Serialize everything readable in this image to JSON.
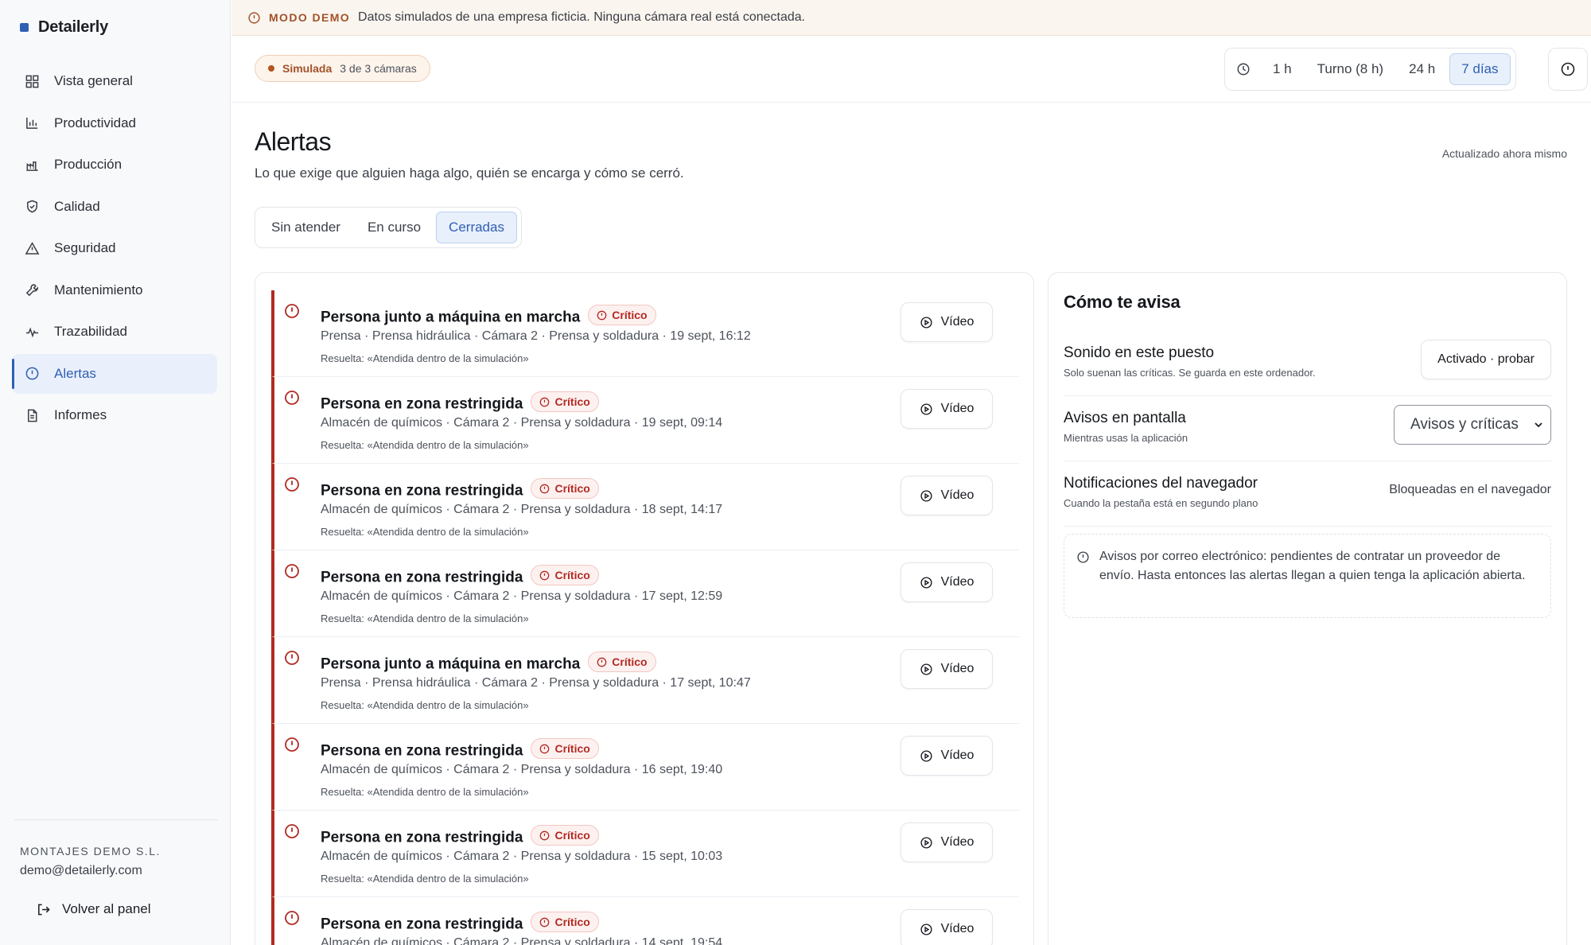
{
  "brand": {
    "name": "Detailerly",
    "color": "#2f5fb3"
  },
  "sidebar": {
    "items": [
      {
        "label": "Vista general",
        "icon": "dashboard-icon"
      },
      {
        "label": "Productividad",
        "icon": "bar-chart-icon"
      },
      {
        "label": "Producción",
        "icon": "factory-icon"
      },
      {
        "label": "Calidad",
        "icon": "shield-check-icon"
      },
      {
        "label": "Seguridad",
        "icon": "warning-triangle-icon"
      },
      {
        "label": "Mantenimiento",
        "icon": "wrench-icon"
      },
      {
        "label": "Trazabilidad",
        "icon": "pulse-icon"
      },
      {
        "label": "Alertas",
        "icon": "alert-circle-icon",
        "active": true
      },
      {
        "label": "Informes",
        "icon": "document-icon"
      }
    ],
    "company": "MONTAJES DEMO S.L.",
    "email": "demo@detailerly.com",
    "back_label": "Volver al panel"
  },
  "banner": {
    "tag": "MODO DEMO",
    "text": "Datos simulados de una empresa ficticia. Ninguna cámara real está conectada.",
    "color": "#a1522a"
  },
  "topbar": {
    "sim_label": "Simulada",
    "sim_count": "3 de 3 cámaras",
    "ranges": [
      "1 h",
      "Turno (8 h)",
      "24 h",
      "7 días"
    ],
    "active_range": "7 días"
  },
  "page": {
    "title": "Alertas",
    "subtitle": "Lo que exige que alguien haga algo, quién se encarga y cómo se cerró.",
    "updated": "Actualizado ahora mismo"
  },
  "tabs": [
    "Sin atender",
    "En curso",
    "Cerradas"
  ],
  "active_tab": "Cerradas",
  "alerts": [
    {
      "title": "Persona junto a máquina en marcha",
      "badge": "Crítico",
      "meta": "Prensa · Prensa hidráulica · Cámara 2 · Prensa y soldadura · 19 sept, 16:12",
      "resolution": "Resuelta: «Atendida dentro de la simulación»",
      "video_label": "Vídeo"
    },
    {
      "title": "Persona en zona restringida",
      "badge": "Crítico",
      "meta": "Almacén de químicos · Cámara 2 · Prensa y soldadura · 19 sept, 09:14",
      "resolution": "Resuelta: «Atendida dentro de la simulación»",
      "video_label": "Vídeo"
    },
    {
      "title": "Persona en zona restringida",
      "badge": "Crítico",
      "meta": "Almacén de químicos · Cámara 2 · Prensa y soldadura · 18 sept, 14:17",
      "resolution": "Resuelta: «Atendida dentro de la simulación»",
      "video_label": "Vídeo"
    },
    {
      "title": "Persona en zona restringida",
      "badge": "Crítico",
      "meta": "Almacén de químicos · Cámara 2 · Prensa y soldadura · 17 sept, 12:59",
      "resolution": "Resuelta: «Atendida dentro de la simulación»",
      "video_label": "Vídeo"
    },
    {
      "title": "Persona junto a máquina en marcha",
      "badge": "Crítico",
      "meta": "Prensa · Prensa hidráulica · Cámara 2 · Prensa y soldadura · 17 sept, 10:47",
      "resolution": "Resuelta: «Atendida dentro de la simulación»",
      "video_label": "Vídeo"
    },
    {
      "title": "Persona en zona restringida",
      "badge": "Crítico",
      "meta": "Almacén de químicos · Cámara 2 · Prensa y soldadura · 16 sept, 19:40",
      "resolution": "Resuelta: «Atendida dentro de la simulación»",
      "video_label": "Vídeo"
    },
    {
      "title": "Persona en zona restringida",
      "badge": "Crítico",
      "meta": "Almacén de químicos · Cámara 2 · Prensa y soldadura · 15 sept, 10:03",
      "resolution": "Resuelta: «Atendida dentro de la simulación»",
      "video_label": "Vídeo"
    },
    {
      "title": "Persona en zona restringida",
      "badge": "Crítico",
      "meta": "Almacén de químicos · Cámara 2 · Prensa y soldadura · 14 sept, 19:54",
      "resolution": "",
      "video_label": "Vídeo"
    }
  ],
  "notify": {
    "title": "Cómo te avisa",
    "sound": {
      "label": "Sonido en este puesto",
      "help": "Solo suenan las críticas. Se guarda en este ordenador.",
      "button": "Activado · probar"
    },
    "screen": {
      "label": "Avisos en pantalla",
      "help": "Mientras usas la aplicación",
      "selected": "Avisos y críticas"
    },
    "browser": {
      "label": "Notificaciones del navegador",
      "help": "Cuando la pestaña está en segundo plano",
      "status": "Bloqueadas en el navegador"
    },
    "email_note": "Avisos por correo electrónico: pendientes de contratar un proveedor de envío. Hasta entonces las alertas llegan a quien tenga la aplicación abierta."
  },
  "colors": {
    "critical": "#b22a22",
    "accent": "#2f5fb3",
    "demo": "#a1522a"
  }
}
